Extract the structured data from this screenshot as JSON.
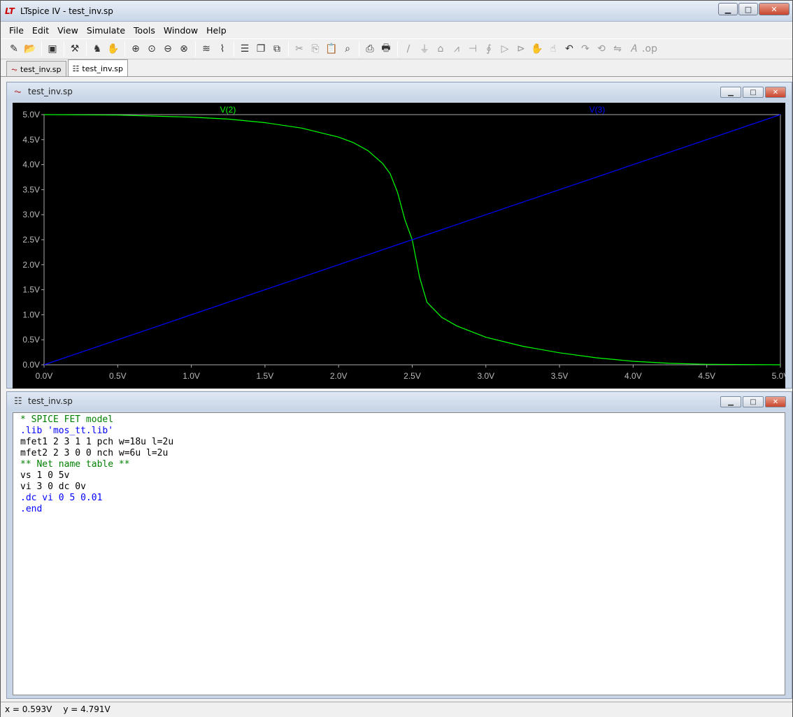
{
  "window": {
    "title": "LTspice IV - test_inv.sp",
    "min_label": "▁",
    "max_label": "□",
    "close_label": "✕"
  },
  "menu": [
    "File",
    "Edit",
    "View",
    "Simulate",
    "Tools",
    "Window",
    "Help"
  ],
  "toolbar_icons": [
    "new-schematic-icon",
    "open-icon",
    "save-icon",
    "control-panel-icon",
    "run-icon",
    "pan-icon",
    "zoom-in-icon",
    "zoom-area-icon",
    "zoom-out-icon",
    "zoom-cancel-icon",
    "autorange-icon",
    "pick-traces-icon",
    "tile-horizontal-icon",
    "cascade-icon",
    "close-all-icon",
    "cut-icon",
    "copy-icon",
    "paste-icon",
    "find-icon",
    "print-setup-icon",
    "print-icon",
    "wire-icon",
    "ground-icon",
    "label-icon",
    "resistor-icon",
    "capacitor-icon",
    "inductor-icon",
    "diode-icon",
    "component-icon",
    "move-icon",
    "drag-icon",
    "undo-icon",
    "redo-icon",
    "rotate-icon",
    "mirror-icon",
    "text-icon",
    "spice-directive-icon"
  ],
  "tabs": [
    {
      "label": "test_inv.sp",
      "icon": "waveform-icon",
      "active": false
    },
    {
      "label": "test_inv.sp",
      "icon": "netlist-icon",
      "active": true
    }
  ],
  "plot_window": {
    "title": "test_inv.sp"
  },
  "text_window": {
    "title": "test_inv.sp"
  },
  "netlist": [
    {
      "text": "* SPICE FET model",
      "color": "#008000"
    },
    {
      "text": ".lib 'mos_tt.lib'",
      "color": "#0000ff"
    },
    {
      "text": "mfet1 2 3 1 1 pch w=18u l=2u",
      "color": "#000000"
    },
    {
      "text": "mfet2 2 3 0 0 nch w=6u l=2u",
      "color": "#000000"
    },
    {
      "text": "** Net name table **",
      "color": "#008000"
    },
    {
      "text": "vs 1 0 5v",
      "color": "#000000"
    },
    {
      "text": "vi 3 0 dc 0v",
      "color": "#000000"
    },
    {
      "text": ".dc vi 0 5 0.01",
      "color": "#0000ff"
    },
    {
      "text": ".end",
      "color": "#0000ff"
    }
  ],
  "status": {
    "x": "x = 0.593V",
    "y": "y = 4.791V"
  },
  "chart_data": {
    "type": "line",
    "xlim": [
      0,
      5
    ],
    "ylim": [
      0,
      5
    ],
    "x_ticks": [
      "0.0V",
      "0.5V",
      "1.0V",
      "1.5V",
      "2.0V",
      "2.5V",
      "3.0V",
      "3.5V",
      "4.0V",
      "4.5V",
      "5.0V"
    ],
    "y_ticks": [
      "0.0V",
      "0.5V",
      "1.0V",
      "1.5V",
      "2.0V",
      "2.5V",
      "3.0V",
      "3.5V",
      "4.0V",
      "4.5V",
      "5.0V"
    ],
    "grid": false,
    "series": [
      {
        "name": "V(2)",
        "color": "#00ff00",
        "x": [
          0,
          0.5,
          1.0,
          1.25,
          1.5,
          1.75,
          2.0,
          2.1,
          2.2,
          2.3,
          2.35,
          2.4,
          2.45,
          2.5,
          2.55,
          2.6,
          2.7,
          2.8,
          3.0,
          3.25,
          3.5,
          3.75,
          4.0,
          4.25,
          4.5,
          5.0
        ],
        "values": [
          5.0,
          4.99,
          4.95,
          4.91,
          4.84,
          4.73,
          4.55,
          4.44,
          4.28,
          4.02,
          3.82,
          3.45,
          2.9,
          2.5,
          1.75,
          1.25,
          0.95,
          0.78,
          0.55,
          0.37,
          0.24,
          0.14,
          0.07,
          0.03,
          0.01,
          0.0
        ]
      },
      {
        "name": "V(3)",
        "color": "#0000ff",
        "x": [
          0,
          5
        ],
        "values": [
          0,
          5
        ]
      }
    ]
  }
}
